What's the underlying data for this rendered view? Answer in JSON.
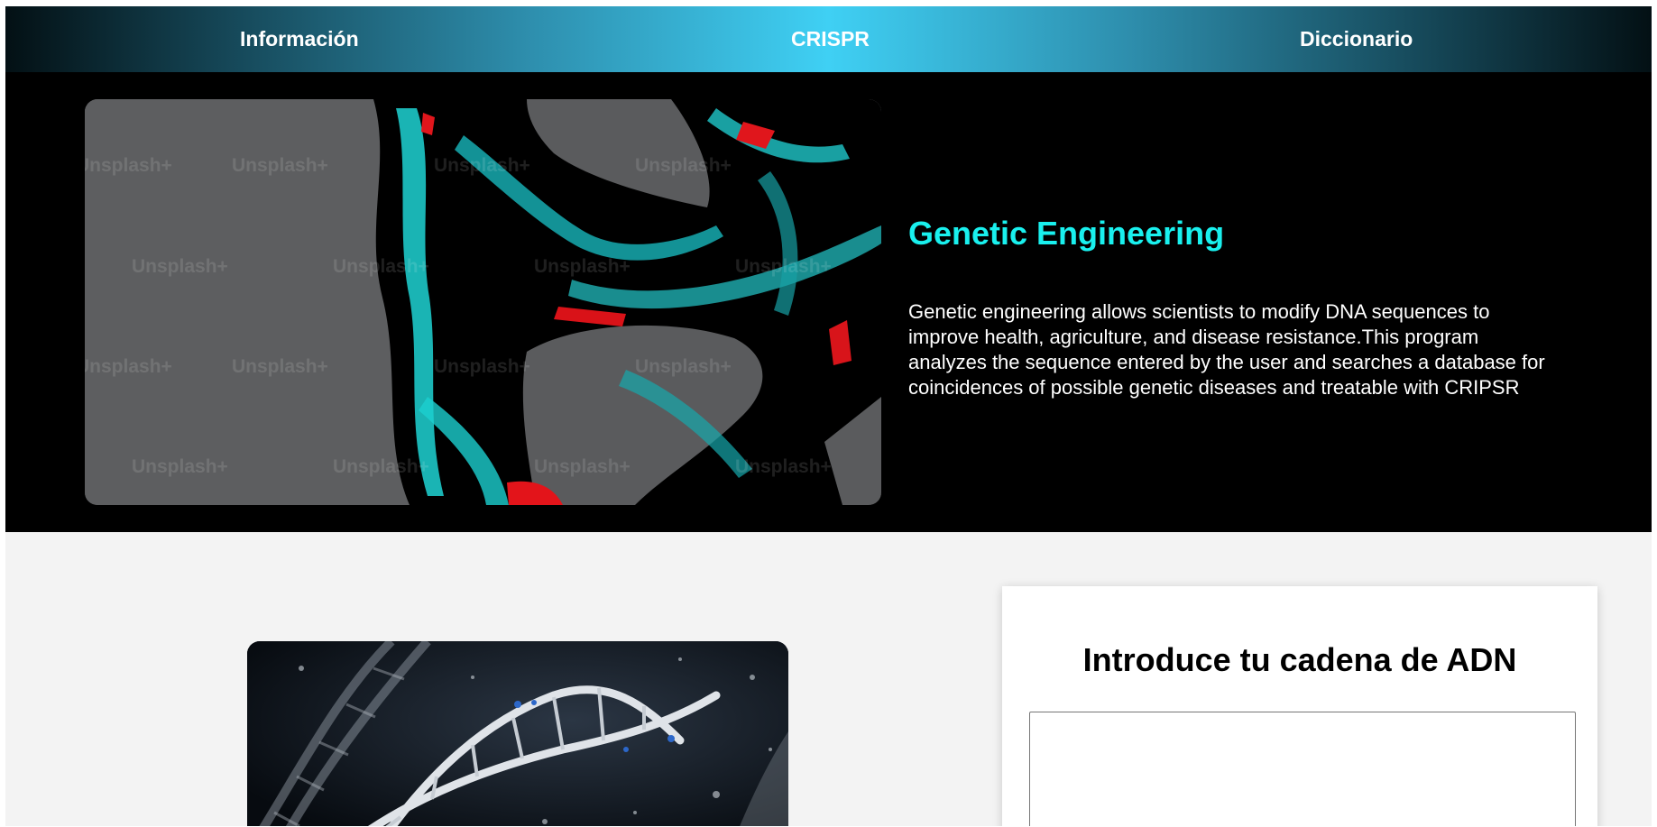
{
  "nav": {
    "items": [
      "Información",
      "CRISPR",
      "Diccionario"
    ]
  },
  "hero": {
    "title": "Genetic Engineering",
    "description": "Genetic engineering allows scientists to modify DNA sequences to improve health, agriculture, and disease resistance.This program analyzes the sequence entered by the user and searches a database for coincidences of possible genetic diseases and treatable with CRIPSR",
    "image": {
      "watermark": "Unsplash+",
      "subject": "abstract-dna-glass-render"
    }
  },
  "form": {
    "title": "Introduce tu cadena de ADN",
    "input_value": ""
  },
  "dna_image": {
    "subject": "dna-double-helix"
  },
  "colors": {
    "accent": "#19f0ee",
    "nav_center": "#3fd0f4",
    "hero_bg": "#000000",
    "page_bg": "#f3f3f3"
  }
}
